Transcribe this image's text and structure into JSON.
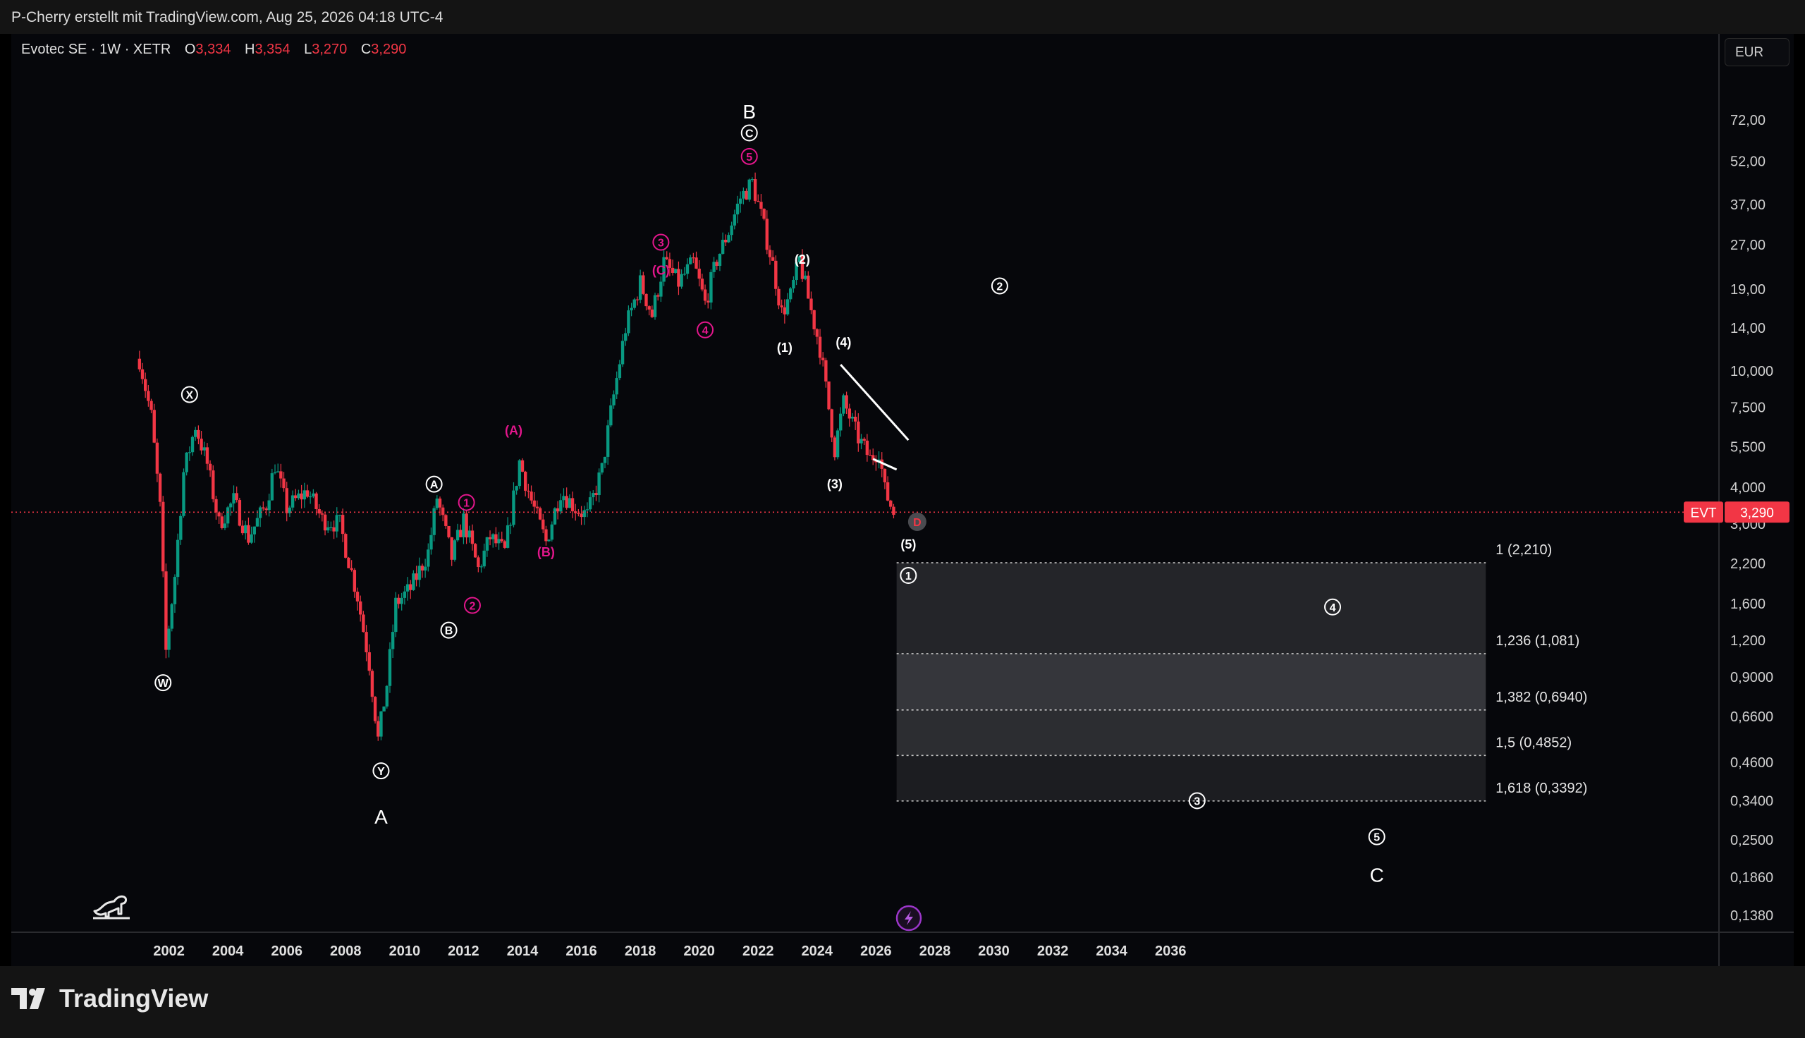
{
  "header": {
    "author_line": "P-Cherry erstellt mit TradingView.com, Aug 25, 2026 04:18 UTC-4"
  },
  "legend": {
    "symbol": "Evotec SE · 1W · XETR",
    "o_label": "O",
    "o_value": "3,334",
    "h_label": "H",
    "h_value": "3,354",
    "l_label": "L",
    "l_value": "3,270",
    "c_label": "C",
    "c_value": "3,290"
  },
  "currency": "EUR",
  "price_tag": {
    "ticker": "EVT",
    "value": "3,290",
    "color": "#f23645"
  },
  "brand": "TradingView",
  "colors": {
    "wave_magenta": "#e3168c",
    "wave_white": "#ffffff",
    "last_price": "#f23645",
    "zone_fill": "#2c2d31",
    "candle_up": "#089981",
    "candle_down": "#f23645"
  },
  "chart_data": {
    "type": "candlestick",
    "y_scale": "log",
    "ylim": [
      0.13,
      105
    ],
    "xlim": [
      2000.5,
      2038.4
    ],
    "x_ticks": [
      "2002",
      "2004",
      "2006",
      "2008",
      "2010",
      "2012",
      "2014",
      "2016",
      "2018",
      "2020",
      "2022",
      "2024",
      "2026",
      "2028",
      "2030",
      "2032",
      "2034",
      "2036"
    ],
    "y_ticks": [
      {
        "value": 72,
        "label": "72,00"
      },
      {
        "value": 52,
        "label": "52,00"
      },
      {
        "value": 37,
        "label": "37,00"
      },
      {
        "value": 27,
        "label": "27,00"
      },
      {
        "value": 19,
        "label": "19,00"
      },
      {
        "value": 14,
        "label": "14,00"
      },
      {
        "value": 10,
        "label": "10,000"
      },
      {
        "value": 7.5,
        "label": "7,500"
      },
      {
        "value": 5.5,
        "label": "5,500"
      },
      {
        "value": 4.0,
        "label": "4,000"
      },
      {
        "value": 3.0,
        "label": "3,000"
      },
      {
        "value": 2.2,
        "label": "2,200"
      },
      {
        "value": 1.6,
        "label": "1,600"
      },
      {
        "value": 1.2,
        "label": "1,200"
      },
      {
        "value": 0.9,
        "label": "0,9000"
      },
      {
        "value": 0.66,
        "label": "0,6600"
      },
      {
        "value": 0.46,
        "label": "0,4600"
      },
      {
        "value": 0.34,
        "label": "0,3400"
      },
      {
        "value": 0.25,
        "label": "0,2500"
      },
      {
        "value": 0.186,
        "label": "0,1860"
      },
      {
        "value": 0.138,
        "label": "0,1380"
      }
    ],
    "last_price": 3.29,
    "price_path": [
      [
        2001.0,
        11.0
      ],
      [
        2001.4,
        7.0
      ],
      [
        2001.7,
        3.4
      ],
      [
        2001.9,
        1.1
      ],
      [
        2002.2,
        2.0
      ],
      [
        2002.5,
        4.5
      ],
      [
        2002.9,
        6.5
      ],
      [
        2003.3,
        4.8
      ],
      [
        2003.7,
        3.0
      ],
      [
        2004.2,
        3.6
      ],
      [
        2004.7,
        2.7
      ],
      [
        2005.3,
        3.5
      ],
      [
        2005.6,
        4.8
      ],
      [
        2006.0,
        3.4
      ],
      [
        2006.7,
        3.9
      ],
      [
        2007.2,
        3.1
      ],
      [
        2007.8,
        3.0
      ],
      [
        2008.4,
        1.7
      ],
      [
        2008.8,
        1.0
      ],
      [
        2009.1,
        0.55
      ],
      [
        2009.4,
        0.85
      ],
      [
        2009.7,
        1.6
      ],
      [
        2010.2,
        1.8
      ],
      [
        2010.8,
        2.4
      ],
      [
        2011.1,
        3.7
      ],
      [
        2011.6,
        2.3
      ],
      [
        2012.0,
        3.1
      ],
      [
        2012.5,
        2.1
      ],
      [
        2012.9,
        2.7
      ],
      [
        2013.4,
        2.4
      ],
      [
        2013.9,
        4.9
      ],
      [
        2014.3,
        3.6
      ],
      [
        2014.8,
        2.6
      ],
      [
        2015.3,
        3.9
      ],
      [
        2015.8,
        3.4
      ],
      [
        2016.2,
        3.2
      ],
      [
        2016.7,
        4.6
      ],
      [
        2017.0,
        7.2
      ],
      [
        2017.5,
        14.0
      ],
      [
        2018.0,
        20.0
      ],
      [
        2018.4,
        15.5
      ],
      [
        2018.8,
        23.5
      ],
      [
        2019.3,
        20.0
      ],
      [
        2019.8,
        23.5
      ],
      [
        2020.2,
        17.0
      ],
      [
        2020.6,
        24.0
      ],
      [
        2021.0,
        30.0
      ],
      [
        2021.4,
        39.0
      ],
      [
        2021.8,
        44.0
      ],
      [
        2022.1,
        34.0
      ],
      [
        2022.5,
        23.0
      ],
      [
        2022.8,
        15.8
      ],
      [
        2023.1,
        18.0
      ],
      [
        2023.4,
        24.0
      ],
      [
        2023.8,
        16.0
      ],
      [
        2024.1,
        12.0
      ],
      [
        2024.6,
        5.4
      ],
      [
        2024.9,
        7.8
      ],
      [
        2025.4,
        5.9
      ],
      [
        2025.8,
        5.0
      ],
      [
        2026.1,
        5.4
      ],
      [
        2026.3,
        3.9
      ],
      [
        2026.6,
        3.29
      ]
    ],
    "fib_levels": [
      {
        "ratio": "1",
        "value": 2.21,
        "label": "1 (2,210)"
      },
      {
        "ratio": "1,236",
        "value": 1.081,
        "label": "1,236 (1,081)"
      },
      {
        "ratio": "1,382",
        "value": 0.694,
        "label": "1,382 (0,6940)"
      },
      {
        "ratio": "1,5",
        "value": 0.4852,
        "label": "1,5 (0,4852)"
      },
      {
        "ratio": "1,618",
        "value": 0.3392,
        "label": "1,618 (0,3392)"
      }
    ],
    "fib_x_range": [
      2026.7,
      2046.7
    ],
    "wedge_lines": [
      [
        [
          2024.8,
          10.5
        ],
        [
          2027.1,
          5.8
        ]
      ],
      [
        [
          2025.9,
          5.0
        ],
        [
          2026.7,
          4.6
        ]
      ]
    ],
    "wave_labels": [
      {
        "text": "B",
        "x": 2021.7,
        "y": 77,
        "style": "letter"
      },
      {
        "text": "C",
        "x": 2021.7,
        "y": 65,
        "style": "circle-white"
      },
      {
        "text": "5",
        "x": 2021.7,
        "y": 54,
        "style": "circle-magenta"
      },
      {
        "text": "3",
        "x": 2018.7,
        "y": 27.5,
        "style": "circle-magenta"
      },
      {
        "text": "(C)",
        "x": 2018.7,
        "y": 22,
        "style": "paren-magenta"
      },
      {
        "text": "4",
        "x": 2020.2,
        "y": 13.8,
        "style": "circle-magenta"
      },
      {
        "text": "(2)",
        "x": 2023.5,
        "y": 24,
        "style": "paren-white"
      },
      {
        "text": "(1)",
        "x": 2022.9,
        "y": 12.0,
        "style": "paren-white"
      },
      {
        "text": "(4)",
        "x": 2024.9,
        "y": 12.5,
        "style": "paren-white"
      },
      {
        "text": "(3)",
        "x": 2024.6,
        "y": 4.1,
        "style": "paren-white"
      },
      {
        "text": "2",
        "x": 2030.2,
        "y": 19.5,
        "style": "circle-white"
      },
      {
        "text": "X",
        "x": 2002.7,
        "y": 8.3,
        "style": "circle-white"
      },
      {
        "text": "W",
        "x": 2001.8,
        "y": 0.86,
        "style": "circle-white"
      },
      {
        "text": "Y",
        "x": 2009.2,
        "y": 0.43,
        "style": "circle-white"
      },
      {
        "text": "A",
        "x": 2009.2,
        "y": 0.3,
        "style": "letter"
      },
      {
        "text": "A",
        "x": 2011.0,
        "y": 4.1,
        "style": "circle-white"
      },
      {
        "text": "1",
        "x": 2012.1,
        "y": 3.55,
        "style": "circle-magenta"
      },
      {
        "text": "B",
        "x": 2011.5,
        "y": 1.3,
        "style": "circle-white"
      },
      {
        "text": "2",
        "x": 2012.3,
        "y": 1.58,
        "style": "circle-magenta"
      },
      {
        "text": "(A)",
        "x": 2013.7,
        "y": 6.25,
        "style": "paren-magenta"
      },
      {
        "text": "(B)",
        "x": 2014.8,
        "y": 2.4,
        "style": "paren-magenta"
      },
      {
        "text": "D",
        "x": 2027.4,
        "y": 3.05,
        "style": "circle-red"
      },
      {
        "text": "(5)",
        "x": 2027.1,
        "y": 2.55,
        "style": "paren-white"
      },
      {
        "text": "1",
        "x": 2027.1,
        "y": 2.0,
        "style": "circle-white"
      },
      {
        "text": "4",
        "x": 2041.5,
        "y": 1.56,
        "style": "circle-white"
      },
      {
        "text": "3",
        "x": 2036.9,
        "y": 0.34,
        "style": "circle-white"
      },
      {
        "text": "5",
        "x": 2043.0,
        "y": 0.256,
        "style": "circle-white"
      },
      {
        "text": "C",
        "x": 2043.0,
        "y": 0.19,
        "style": "letter"
      }
    ]
  }
}
